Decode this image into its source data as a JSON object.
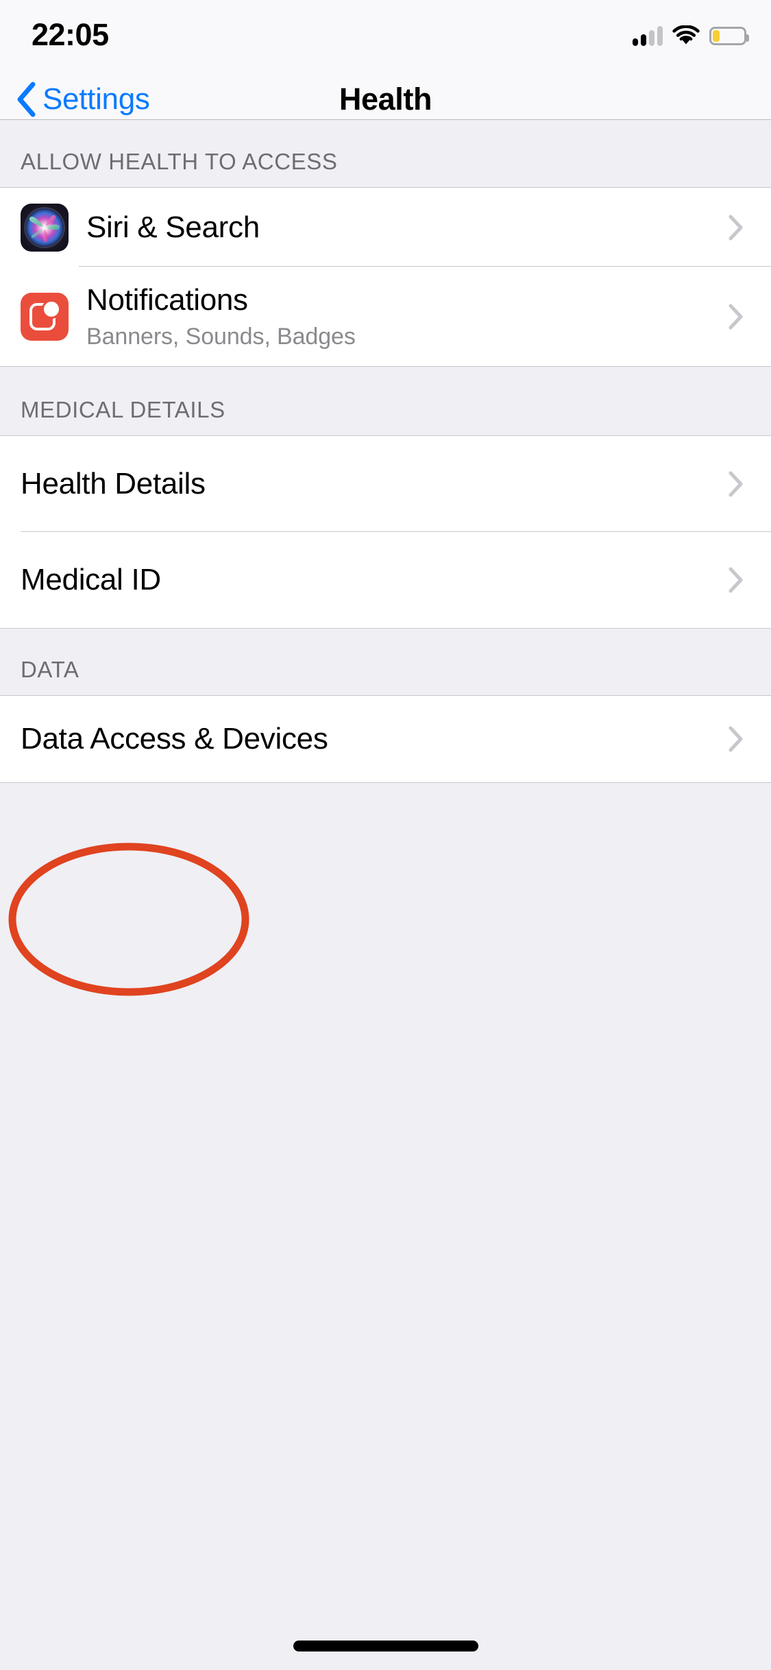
{
  "status_bar": {
    "time": "22:05",
    "cellular_icon": "cellular-signal-icon",
    "cellular_bars_total": 4,
    "cellular_bars_active": 2,
    "wifi_icon": "wifi-icon",
    "battery_icon": "battery-icon",
    "battery_level_percent": 20,
    "battery_color": "#F9CE34"
  },
  "nav": {
    "back_label": "Settings",
    "back_icon": "chevron-left-icon",
    "title": "Health",
    "tint_color": "#0A7AFF"
  },
  "sections": [
    {
      "header": "ALLOW HEALTH TO ACCESS",
      "rows": [
        {
          "title": "Siri & Search",
          "subtitle": "",
          "icon": "siri-app-icon",
          "accessory": "chevron-right-icon"
        },
        {
          "title": "Notifications",
          "subtitle": "Banners, Sounds, Badges",
          "icon": "notifications-app-icon",
          "accessory": "chevron-right-icon"
        }
      ]
    },
    {
      "header": "MEDICAL DETAILS",
      "rows": [
        {
          "title": "Health Details",
          "subtitle": "",
          "icon": "",
          "accessory": "chevron-right-icon"
        },
        {
          "title": "Medical ID",
          "subtitle": "",
          "icon": "",
          "accessory": "chevron-right-icon"
        }
      ]
    },
    {
      "header": "DATA",
      "rows": [
        {
          "title": "Data Access & Devices",
          "subtitle": "",
          "icon": "",
          "accessory": "chevron-right-icon"
        }
      ]
    }
  ],
  "annotation": {
    "shape": "ellipse",
    "color": "#E0431F",
    "stroke_width": 10,
    "targets": "Data Access & Devices"
  },
  "home_indicator": {
    "icon": "home-indicator-bar",
    "color": "#000000"
  }
}
